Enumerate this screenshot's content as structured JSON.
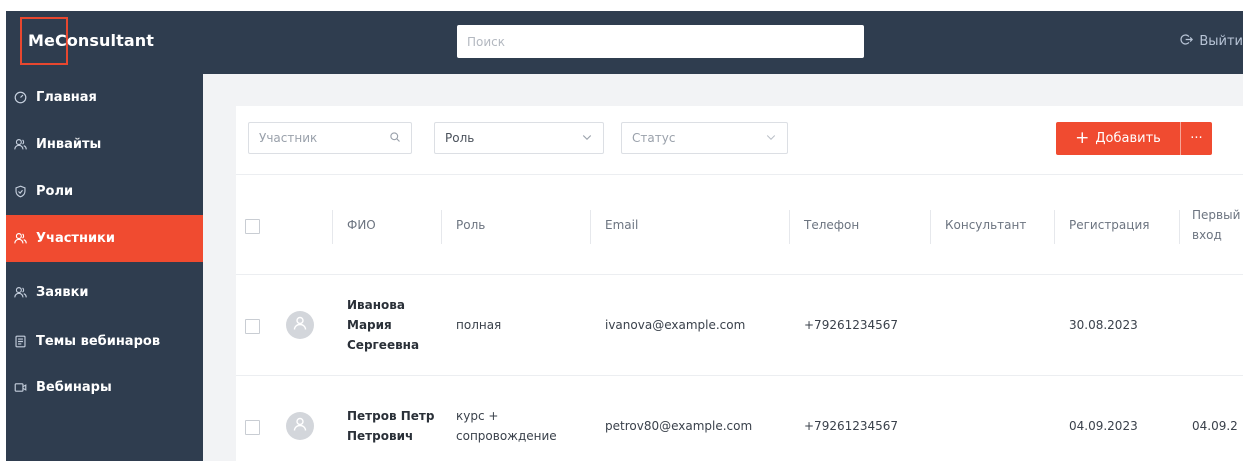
{
  "header": {
    "logo": "MeConsultant",
    "search_placeholder": "Поиск",
    "logout_label": "Выйти"
  },
  "sidebar": {
    "items": [
      {
        "label": "Главная",
        "icon": "dashboard-icon",
        "active": false
      },
      {
        "label": "Инвайты",
        "icon": "users-icon",
        "active": false
      },
      {
        "label": "Роли",
        "icon": "shield-icon",
        "active": false
      },
      {
        "label": "Участники",
        "icon": "users-icon",
        "active": true
      },
      {
        "label": "Заявки",
        "icon": "users-icon",
        "active": false
      },
      {
        "label": "Темы вебинаров",
        "icon": "document-icon",
        "active": false
      },
      {
        "label": "Вебинары",
        "icon": "video-icon",
        "active": false
      }
    ]
  },
  "filters": {
    "participant_placeholder": "Участник",
    "role_value": "Роль",
    "status_placeholder": "Статус",
    "add_label": "Добавить",
    "more_label": "···"
  },
  "table": {
    "columns": [
      "ФИО",
      "Роль",
      "Email",
      "Телефон",
      "Консультант",
      "Регистрация",
      "Первый вход"
    ],
    "rows": [
      {
        "name": "Иванова Мария Сергеевна",
        "role": "полная",
        "email": "ivanova@example.com",
        "phone": "+79261234567",
        "consultant": "",
        "registration": "30.08.2023",
        "first_login": ""
      },
      {
        "name": "Петров Петр Петрович",
        "role": "курс + сопровождение",
        "email": "petrov80@example.com",
        "phone": "+79261234567",
        "consultant": "",
        "registration": "04.09.2023",
        "first_login": "04.09.2"
      }
    ]
  },
  "colors": {
    "sidebar_bg": "#2f3d4f",
    "accent": "#f04b30",
    "main_bg": "#f2f3f5"
  }
}
